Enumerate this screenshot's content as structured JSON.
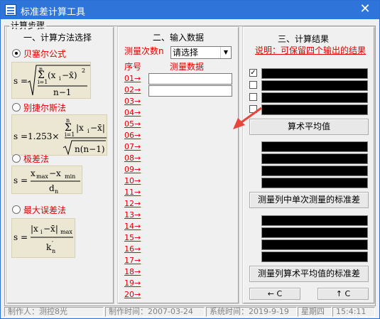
{
  "window": {
    "title": "标准差计算工具",
    "close_label": "✕",
    "app_icon": "app-icon"
  },
  "steps_label": "计算步骤",
  "section1": {
    "title": "一、计算方法选择",
    "methods": [
      {
        "label": "贝塞尔公式",
        "selected": true
      },
      {
        "label": "别捷尔斯法",
        "selected": false
      },
      {
        "label": "极差法",
        "selected": false
      },
      {
        "label": "最大误差法",
        "selected": false
      }
    ],
    "formulas": [
      {
        "lhs": "s =",
        "num_sub": "i=1",
        "num_sup": "n",
        "num_expr": "(x",
        "num_i": "i",
        "num_rest": "−x̄)",
        "num_pow": "2",
        "den": "n−1"
      },
      {
        "lhs": "s =1.253×",
        "num_sub": "i=1",
        "num_sup": "n",
        "num_expr": "|x",
        "num_i": "i",
        "num_rest": "−x̄|",
        "den": "n(n−1)"
      },
      {
        "lhs": "s =",
        "num": "x",
        "num_sub1": "max",
        "minus": "−x",
        "num_sub2": "min",
        "den": "d",
        "den_sub": "n"
      },
      {
        "lhs": "s =",
        "num": "|x",
        "num_i": "i",
        "num_rest": "−x̄|",
        "num_sub": "max",
        "den": "k",
        "den_sub": "n",
        "den_prime": "′"
      }
    ]
  },
  "section2": {
    "title": "二、输入数据",
    "count_label": "测量次数n",
    "count_select": "请选择",
    "col_index": "序号",
    "col_data": "测量数据",
    "rows": [
      "01→",
      "02→",
      "03→",
      "04→",
      "05→",
      "06→",
      "07→",
      "08→",
      "09→",
      "10→",
      "11→",
      "12→",
      "13→",
      "14→",
      "15→",
      "16→",
      "17→",
      "18→",
      "19→",
      "20→"
    ]
  },
  "section3": {
    "title": "三、计算结果",
    "note": "说明：可保留四个输出的结果",
    "checks": [
      true,
      false,
      false,
      false
    ],
    "btn_mean": "算术平均值",
    "btn_single_std": "测量列中单次测量的标准差",
    "btn_mean_std": "测量列算术平均值的标准差",
    "btn_left": "← C",
    "btn_up": "↑ C"
  },
  "status": {
    "author": "制作人：测控8光",
    "made_time": "制作时间：2007-03-24",
    "sys_label": "系统时间：2019-9-19",
    "weekday": "星期四",
    "clock": "15:4:11"
  },
  "colors": {
    "accent": "#e00000",
    "title_bar": "#2f74d8"
  }
}
